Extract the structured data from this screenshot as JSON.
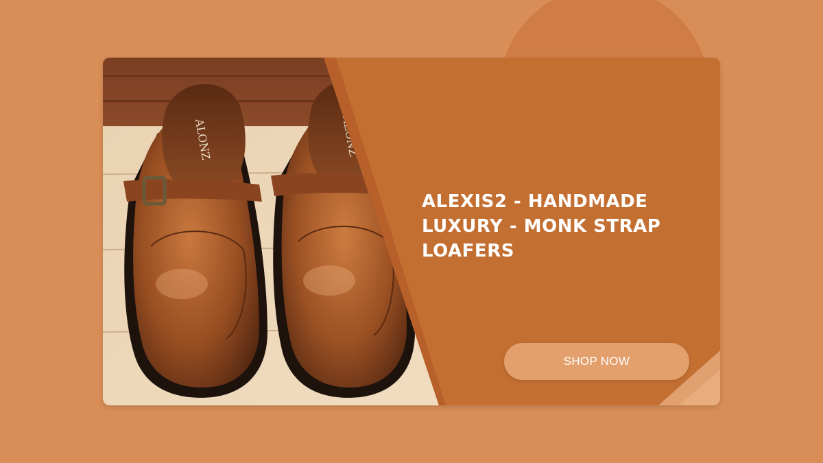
{
  "banner": {
    "title": "ALEXIS2 - HANDMADE LUXURY - MONK STRAP LOAFERS",
    "cta_label": "SHOP NOW",
    "insole_brand_text": "ALONZ"
  },
  "colors": {
    "page_background": "#d98e58",
    "card_background": "#c46f32",
    "button_background": "#e3a06c",
    "title_text": "#ffffff"
  },
  "image": {
    "subject": "pair of brown leather monk strap loafers on wooden floor",
    "icon": "product-photo"
  }
}
